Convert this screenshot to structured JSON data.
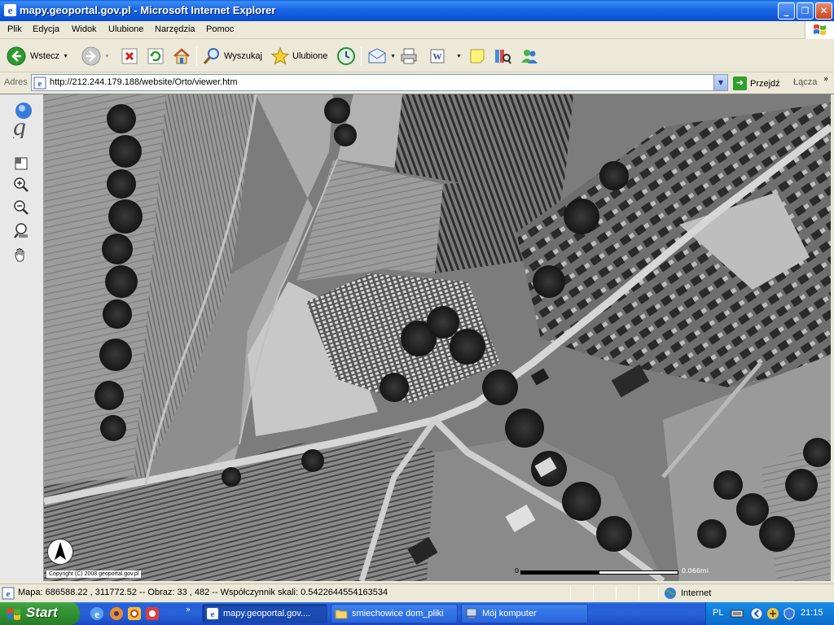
{
  "window": {
    "title": "mapy.geoportal.gov.pl - Microsoft Internet Explorer",
    "controls": {
      "minimize": "_",
      "maximize": "❐",
      "close": "✕"
    }
  },
  "menu": [
    "Plik",
    "Edycja",
    "Widok",
    "Ulubione",
    "Narzędzia",
    "Pomoc"
  ],
  "toolbar": {
    "back_label": "Wstecz",
    "search_label": "Wyszukaj",
    "favorites_label": "Ulubione"
  },
  "address": {
    "label": "Adres",
    "url": "http://212.244.179.188/website/Orto/viewer.htm",
    "go_label": "Przejdź",
    "links_label": "Łącza",
    "more": "»"
  },
  "map": {
    "copyright": "Copyright (C) 2008 geoportal.gov.pl",
    "scale_start": "0",
    "scale_end": "0.066mi",
    "logo_letter": "g"
  },
  "status": {
    "message": "Mapa: 686588.22 , 311772.52 -- Obraz: 33 , 482 -- Współczynnik skali: 0.5422644554163534",
    "zone": "Internet"
  },
  "taskbar": {
    "start_label": "Start",
    "more": "»",
    "tasks": [
      "mapy.geoportal.gov....",
      "smiechowice dom_pliki",
      "Mój komputer"
    ],
    "language": "PL",
    "clock": "21:15"
  },
  "colors": {
    "titlebar": "#0b55d8",
    "taskbar": "#245edb",
    "start": "#3a9a3a",
    "tray": "#0f7ad8",
    "chrome": "#ECE9D8"
  },
  "icons": {
    "toolbar": [
      "back-arrow-icon",
      "forward-arrow-icon",
      "stop-icon",
      "refresh-icon",
      "home-icon",
      "search-icon",
      "favorites-star-icon",
      "history-icon",
      "mail-icon",
      "print-icon",
      "edit-icon",
      "note-icon",
      "research-icon",
      "messenger-icon"
    ],
    "map_tools": [
      "overview-icon",
      "zoom-in-icon",
      "zoom-out-icon",
      "zoom-extent-icon",
      "pan-hand-icon"
    ]
  }
}
